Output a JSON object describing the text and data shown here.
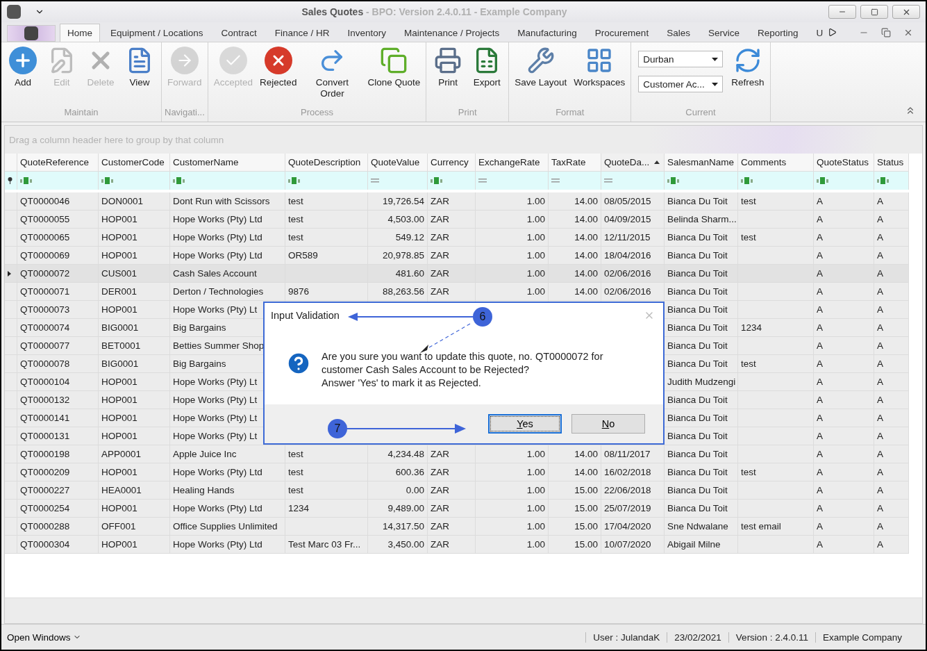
{
  "window": {
    "title": "Sales Quotes",
    "subtitle": " - BPO: Version 2.4.0.11 - Example Company"
  },
  "menu_tabs": [
    {
      "label": "Home",
      "selected": true
    },
    {
      "label": "Equipment / Locations",
      "selected": false
    },
    {
      "label": "Contract",
      "selected": false
    },
    {
      "label": "Finance / HR",
      "selected": false
    },
    {
      "label": "Inventory",
      "selected": false
    },
    {
      "label": "Maintenance / Projects",
      "selected": false
    },
    {
      "label": "Manufacturing",
      "selected": false
    },
    {
      "label": "Procurement",
      "selected": false
    },
    {
      "label": "Sales",
      "selected": false
    },
    {
      "label": "Service",
      "selected": false
    },
    {
      "label": "Reporting",
      "selected": false
    },
    {
      "label": "U",
      "selected": false
    }
  ],
  "ribbon_groups": [
    {
      "label": "Maintain",
      "items": [
        {
          "kind": "add",
          "label": "Add",
          "disabled": false
        },
        {
          "kind": "edit",
          "label": "Edit",
          "disabled": true
        },
        {
          "kind": "delete",
          "label": "Delete",
          "disabled": true
        },
        {
          "kind": "view",
          "label": "View",
          "disabled": false
        }
      ]
    },
    {
      "label": "Navigati...",
      "items": [
        {
          "kind": "forward",
          "label": "Forward",
          "disabled": true
        }
      ]
    },
    {
      "label": "Process",
      "items": [
        {
          "kind": "accept",
          "label": "Accepted",
          "disabled": true
        },
        {
          "kind": "reject",
          "label": "Rejected",
          "disabled": false
        },
        {
          "kind": "convert",
          "label": "Convert Order",
          "disabled": false
        },
        {
          "kind": "clone",
          "label": "Clone Quote",
          "disabled": false
        }
      ]
    },
    {
      "label": "Print",
      "items": [
        {
          "kind": "print",
          "label": "Print",
          "disabled": false
        },
        {
          "kind": "export",
          "label": "Export",
          "disabled": false
        }
      ]
    },
    {
      "label": "Format",
      "items": [
        {
          "kind": "layout",
          "label": "Save Layout",
          "disabled": false
        },
        {
          "kind": "workspaces",
          "label": "Workspaces",
          "disabled": false
        }
      ]
    },
    {
      "label": "Current",
      "dropdowns": [
        "Durban",
        "Customer Ac..."
      ],
      "items": [
        {
          "kind": "refresh",
          "label": "Refresh",
          "disabled": false
        }
      ]
    }
  ],
  "group_panel": {
    "placeholder": "Drag a column header here to group by that column"
  },
  "table": {
    "columns": [
      {
        "label": "QuoteReference",
        "kind": "text",
        "sorted": false
      },
      {
        "label": "CustomerCode",
        "kind": "text",
        "sorted": false
      },
      {
        "label": "CustomerName",
        "kind": "text",
        "sorted": false
      },
      {
        "label": "QuoteDescription",
        "kind": "text",
        "sorted": false
      },
      {
        "label": "QuoteValue",
        "kind": "number",
        "sorted": false
      },
      {
        "label": "Currency",
        "kind": "text",
        "sorted": false
      },
      {
        "label": "ExchangeRate",
        "kind": "number",
        "sorted": false
      },
      {
        "label": "TaxRate",
        "kind": "number",
        "sorted": false
      },
      {
        "label": "QuoteDa...",
        "kind": "date",
        "sorted": true
      },
      {
        "label": "SalesmanName",
        "kind": "text",
        "sorted": false
      },
      {
        "label": "Comments",
        "kind": "text",
        "sorted": false
      },
      {
        "label": "QuoteStatus",
        "kind": "text",
        "sorted": false
      },
      {
        "label": "Status",
        "kind": "text",
        "sorted": false
      }
    ],
    "rows": [
      {
        "selected": false,
        "cells": [
          "QT0000046",
          "DON0001",
          "Dont Run with Scissors",
          "test",
          "19,726.54",
          "ZAR",
          "1.00",
          "14.00",
          "08/05/2015",
          "Bianca Du Toit",
          "test",
          "A",
          "A"
        ]
      },
      {
        "selected": false,
        "cells": [
          "QT0000055",
          "HOP001",
          "Hope Works (Pty) Ltd",
          "test",
          "4,503.00",
          "ZAR",
          "1.00",
          "14.00",
          "04/09/2015",
          "Belinda Sharm...",
          null,
          "A",
          "A"
        ]
      },
      {
        "selected": false,
        "cells": [
          "QT0000065",
          "HOP001",
          "Hope Works (Pty) Ltd",
          "test",
          "549.12",
          "ZAR",
          "1.00",
          "14.00",
          "12/11/2015",
          "Bianca Du Toit",
          "test",
          "A",
          "A"
        ]
      },
      {
        "selected": false,
        "cells": [
          "QT0000069",
          "HOP001",
          "Hope Works (Pty) Ltd",
          "OR589",
          "20,978.85",
          "ZAR",
          "1.00",
          "14.00",
          "18/04/2016",
          "Bianca Du Toit",
          null,
          "A",
          "A"
        ]
      },
      {
        "selected": true,
        "cells": [
          "QT0000072",
          "CUS001",
          "Cash Sales Account",
          null,
          "481.60",
          "ZAR",
          "1.00",
          "14.00",
          "02/06/2016",
          "Bianca Du Toit",
          null,
          "A",
          "A"
        ]
      },
      {
        "selected": false,
        "cells": [
          "QT0000071",
          "DER001",
          "Derton / Technologies",
          "9876",
          "88,263.56",
          "ZAR",
          "1.00",
          "14.00",
          "02/06/2016",
          "Bianca Du Toit",
          null,
          "A",
          "A"
        ]
      },
      {
        "selected": false,
        "cells": [
          "QT0000073",
          "HOP001",
          "Hope Works (Pty) Lt",
          null,
          null,
          null,
          null,
          null,
          null,
          "Bianca Du Toit",
          null,
          "A",
          "A"
        ]
      },
      {
        "selected": false,
        "cells": [
          "QT0000074",
          "BIG0001",
          "Big Bargains",
          null,
          null,
          null,
          null,
          null,
          null,
          "Bianca Du Toit",
          "1234",
          "A",
          "A"
        ]
      },
      {
        "selected": false,
        "cells": [
          "QT0000077",
          "BET0001",
          "Betties Summer Shop",
          null,
          null,
          null,
          null,
          null,
          null,
          "Bianca Du Toit",
          null,
          "A",
          "A"
        ]
      },
      {
        "selected": false,
        "cells": [
          "QT0000078",
          "BIG0001",
          "Big Bargains",
          null,
          null,
          null,
          null,
          null,
          null,
          "Bianca Du Toit",
          "test",
          "A",
          "A"
        ]
      },
      {
        "selected": false,
        "cells": [
          "QT0000104",
          "HOP001",
          "Hope Works (Pty) Lt",
          null,
          null,
          null,
          null,
          null,
          null,
          "Judith Mudzengi",
          null,
          "A",
          "A"
        ]
      },
      {
        "selected": false,
        "cells": [
          "QT0000132",
          "HOP001",
          "Hope Works (Pty) Lt",
          null,
          null,
          null,
          null,
          null,
          null,
          "Bianca Du Toit",
          null,
          "A",
          "A"
        ]
      },
      {
        "selected": false,
        "cells": [
          "QT0000141",
          "HOP001",
          "Hope Works (Pty) Lt",
          null,
          null,
          null,
          null,
          null,
          null,
          "Bianca Du Toit",
          null,
          "A",
          "A"
        ]
      },
      {
        "selected": false,
        "cells": [
          "QT0000131",
          "HOP001",
          "Hope Works (Pty) Lt",
          null,
          null,
          null,
          null,
          null,
          null,
          "Bianca Du Toit",
          null,
          "A",
          "A"
        ]
      },
      {
        "selected": false,
        "cells": [
          "QT0000198",
          "APP0001",
          "Apple Juice Inc",
          "test",
          "4,234.48",
          "ZAR",
          "1.00",
          "14.00",
          "08/11/2017",
          "Bianca Du Toit",
          null,
          "A",
          "A"
        ]
      },
      {
        "selected": false,
        "cells": [
          "QT0000209",
          "HOP001",
          "Hope Works (Pty) Ltd",
          "test",
          "600.36",
          "ZAR",
          "1.00",
          "14.00",
          "16/02/2018",
          "Bianca Du Toit",
          "test",
          "A",
          "A"
        ]
      },
      {
        "selected": false,
        "cells": [
          "QT0000227",
          "HEA0001",
          "Healing Hands",
          "test",
          "0.00",
          "ZAR",
          "1.00",
          "15.00",
          "22/06/2018",
          "Bianca Du Toit",
          null,
          "A",
          "A"
        ]
      },
      {
        "selected": false,
        "cells": [
          "QT0000254",
          "HOP001",
          "Hope Works (Pty) Ltd",
          "1234",
          "9,489.00",
          "ZAR",
          "1.00",
          "15.00",
          "25/07/2019",
          "Bianca Du Toit",
          null,
          "A",
          "A"
        ]
      },
      {
        "selected": false,
        "cells": [
          "QT0000288",
          "OFF001",
          "Office Supplies Unlimited",
          null,
          "14,317.50",
          "ZAR",
          "1.00",
          "15.00",
          "17/04/2020",
          "Sne Ndwalane",
          "test email",
          "A",
          "A"
        ]
      },
      {
        "selected": false,
        "cells": [
          "QT0000304",
          "HOP001",
          "Hope Works (Pty) Ltd",
          "Test Marc 03 Fr...",
          "3,450.00",
          "ZAR",
          "1.00",
          "15.00",
          "10/07/2020",
          "Abigail Milne",
          null,
          "A",
          "A"
        ]
      }
    ]
  },
  "dialog": {
    "title": "Input Validation",
    "message_lines": [
      "Are you sure you want to update this quote, no. QT0000072 for",
      "customer Cash Sales Account to be Rejected?",
      "Answer 'Yes' to mark it as Rejected."
    ],
    "buttons": [
      {
        "label": "Yes",
        "focused": true
      },
      {
        "label": "No",
        "focused": false
      }
    ],
    "callouts": [
      "6",
      "7"
    ]
  },
  "status_bar": {
    "open_windows": "Open Windows",
    "items": [
      "User : JulandaK",
      "23/02/2021",
      "Version : 2.4.0.11",
      "Example Company"
    ]
  }
}
